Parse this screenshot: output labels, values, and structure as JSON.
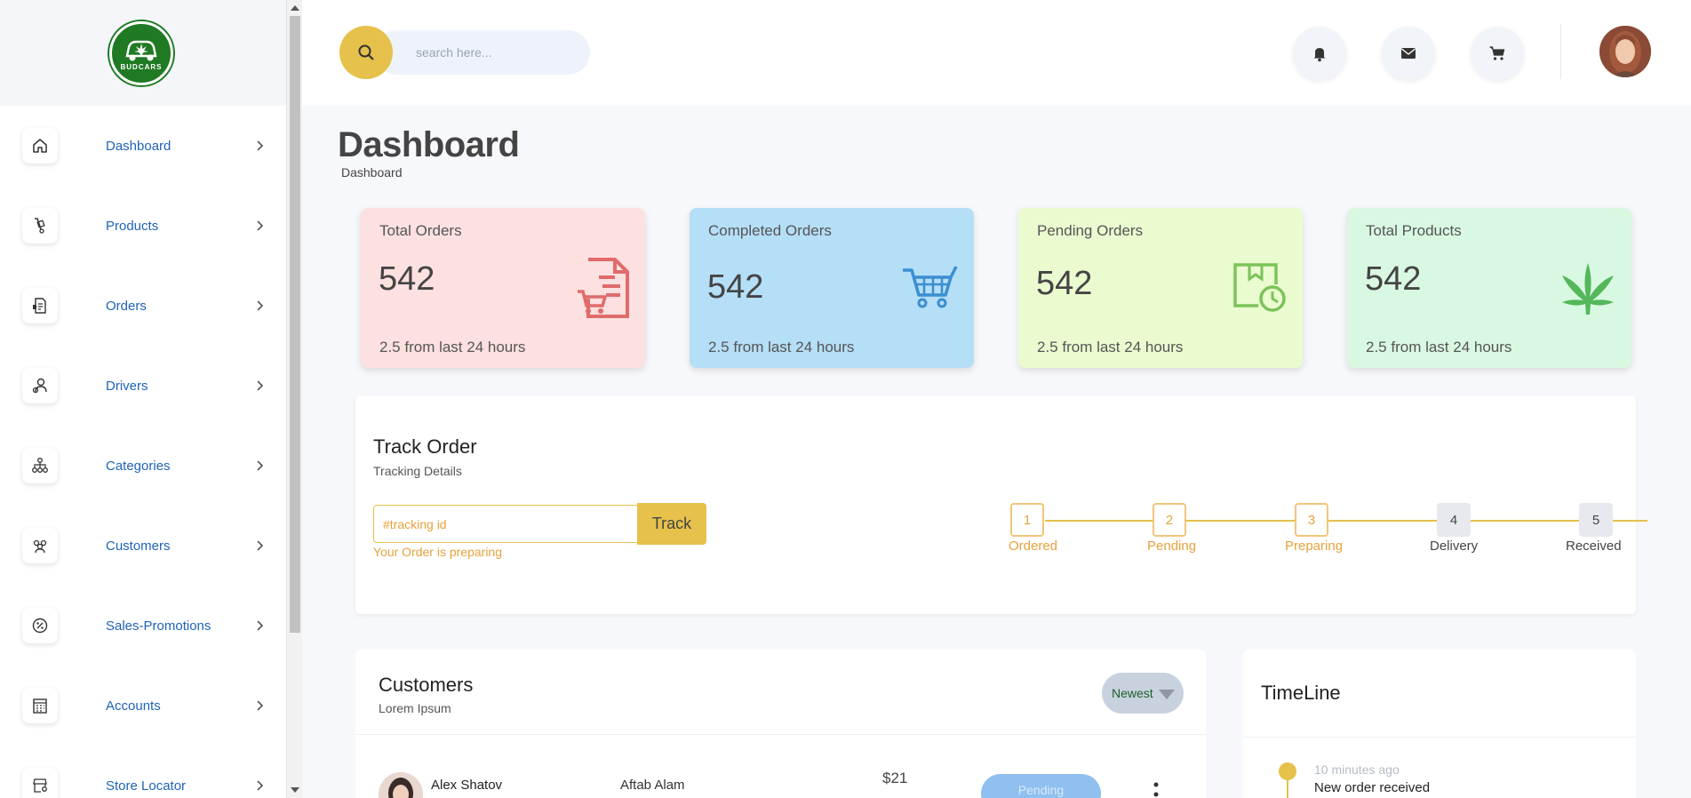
{
  "brand": {
    "logo_text": "BUDCARS"
  },
  "sidebar": {
    "items": [
      {
        "label": "Dashboard",
        "icon": "home-icon"
      },
      {
        "label": "Products",
        "icon": "hand-truck-icon"
      },
      {
        "label": "Orders",
        "icon": "orders-list-icon"
      },
      {
        "label": "Drivers",
        "icon": "driver-icon"
      },
      {
        "label": "Categories",
        "icon": "hierarchy-icon"
      },
      {
        "label": "Customers",
        "icon": "group-icon"
      },
      {
        "label": "Sales-Promotions",
        "icon": "discount-badge-icon"
      },
      {
        "label": "Accounts",
        "icon": "accounts-calculator-icon"
      },
      {
        "label": "Store Locator",
        "icon": "store-location-icon"
      }
    ]
  },
  "header": {
    "search_placeholder": "search here..."
  },
  "page": {
    "title": "Dashboard",
    "breadcrumb": "Dashboard"
  },
  "stats": [
    {
      "title": "Total Orders",
      "value": "542",
      "sub": "2.5 from last 24 hours",
      "bg": "#fde0e0",
      "icon_color": "#e06b6b",
      "icon": "invoice-cart-icon"
    },
    {
      "title": "Completed Orders",
      "value": "542",
      "sub": "2.5 from last 24 hours",
      "bg": "#b5def7",
      "icon_color": "#3a8fd1",
      "icon": "shopping-cart-icon"
    },
    {
      "title": "Pending Orders",
      "value": "542",
      "sub": "2.5 from last 24 hours",
      "bg": "#eafbd0",
      "icon_color": "#7cc35a",
      "icon": "box-clock-icon"
    },
    {
      "title": "Total Products",
      "value": "542",
      "sub": "2.5 from last 24 hours",
      "bg": "#d9f8e2",
      "icon_color": "#54b85a",
      "icon": "cannabis-leaf-icon"
    }
  ],
  "track": {
    "title": "Track Order",
    "subtitle": "Tracking Details",
    "input_placeholder": "#tracking id",
    "button_label": "Track",
    "status": "Your Order is preparing",
    "steps": [
      {
        "num": "1",
        "label": "Ordered",
        "done": true
      },
      {
        "num": "2",
        "label": "Pending",
        "done": true
      },
      {
        "num": "3",
        "label": "Preparing",
        "done": true
      },
      {
        "num": "4",
        "label": "Delivery",
        "done": false
      },
      {
        "num": "5",
        "label": "Received",
        "done": false
      }
    ]
  },
  "customers": {
    "title": "Customers",
    "subtitle": "Lorem Ipsum",
    "sort_label": "Newest",
    "rows": [
      {
        "name": "Alex Shatov",
        "driver": "Aftab Alam",
        "amount": "$21",
        "status": "Pending"
      }
    ]
  },
  "timeline": {
    "title": "TimeLine",
    "items": [
      {
        "time": "10 minutes ago",
        "text": "New order received"
      }
    ]
  },
  "colors": {
    "accent": "#e6c14b",
    "nav_text": "#1e63b8",
    "pending_status": "#8fc0ef"
  }
}
